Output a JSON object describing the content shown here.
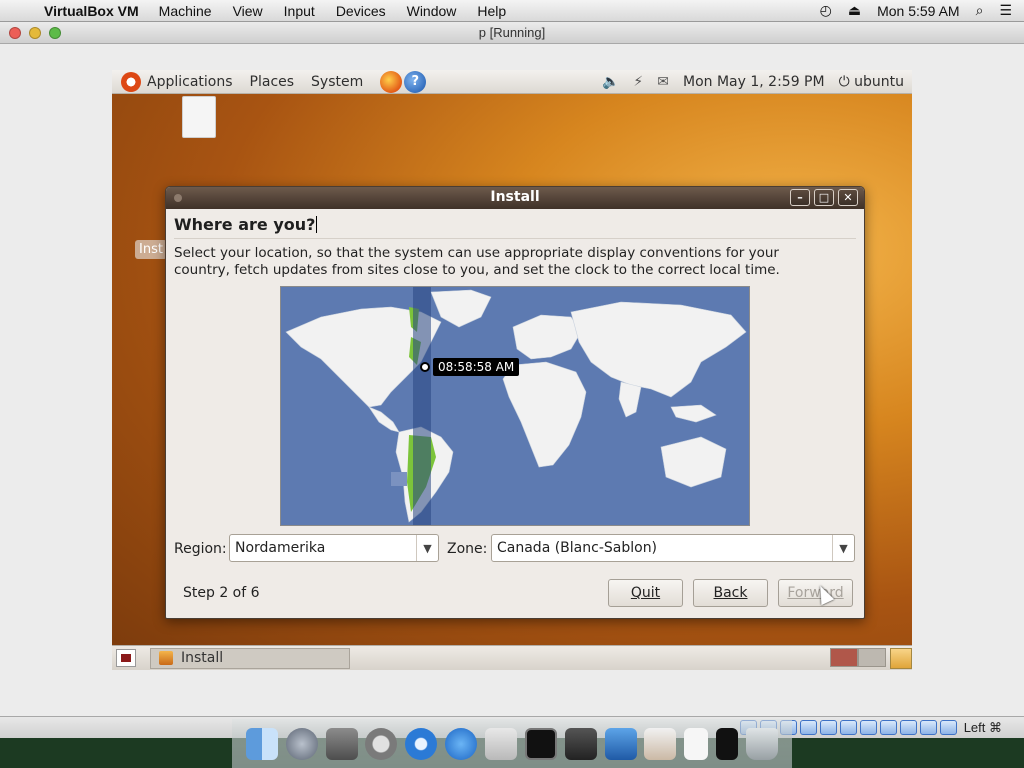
{
  "host_menubar": {
    "app_name": "VirtualBox VM",
    "menus": [
      "Machine",
      "View",
      "Input",
      "Devices",
      "Window",
      "Help"
    ],
    "clock": "Mon 5:59 AM"
  },
  "vm_window": {
    "title": "p [Running]"
  },
  "guest": {
    "top_panel": {
      "menus": [
        "Applications",
        "Places",
        "System"
      ],
      "clock": "Mon May  1,  2:59 PM",
      "user": "ubuntu"
    },
    "desktop_label": "Inst",
    "taskbar": {
      "install_label": "Install"
    }
  },
  "install_dialog": {
    "title": "Install",
    "heading": "Where are you?",
    "description": "Select your location, so that the system can use appropriate display conventions for your country, fetch updates from sites close to you, and set the clock to the correct local time.",
    "map_tooltip": "08:58:58 AM",
    "region_label": "Region:",
    "region_value": "Nordamerika",
    "zone_label": "Zone:",
    "zone_value": "Canada (Blanc-Sablon)",
    "step": "Step 2 of 6",
    "buttons": {
      "quit": "Quit",
      "back": "Back",
      "forward": "Forward"
    },
    "forward_enabled": false
  },
  "vbox_status": {
    "host_key": "Left ⌘"
  },
  "colors": {
    "ocean": "#5d7ab1",
    "land": "#f2f2f2",
    "selected_country": "#7cc43a",
    "dialog_titlebar": "#4a3b31"
  }
}
